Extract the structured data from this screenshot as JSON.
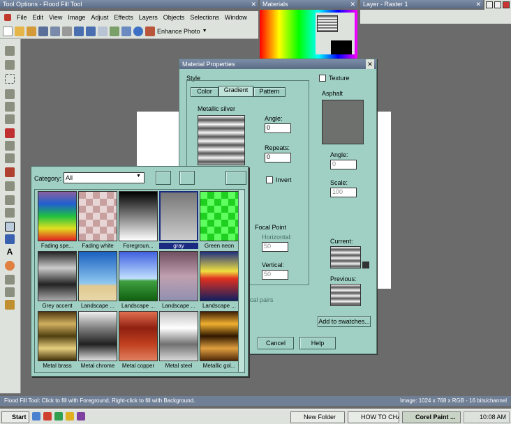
{
  "windows": {
    "tool_options_title": "Tool Options - Flood Fill Tool",
    "materials_title": "Materials",
    "layer_title": "Layer - Raster 1"
  },
  "menu": [
    "File",
    "Edit",
    "View",
    "Image",
    "Adjust",
    "Effects",
    "Layers",
    "Objects",
    "Selections",
    "Window"
  ],
  "toolbar": {
    "enhance_photo": "Enhance Photo"
  },
  "material_properties": {
    "title": "Material Properties",
    "style_label": "Style",
    "tabs": [
      "Color",
      "Gradient",
      "Pattern"
    ],
    "gradient_name": "Metallic silver",
    "angle_label": "Angle:",
    "angle_value": "0",
    "repeats_label": "Repeats:",
    "repeats_value": "0",
    "invert_label": "Invert",
    "focal_point_label": "Focal Point",
    "horizontal_label": "Horizontal:",
    "horizontal_value": "50",
    "vertical_label": "Vertical:",
    "vertical_value": "50",
    "focal_extra": "ocal pairs",
    "texture_label": "Texture",
    "texture_name": "Asphalt",
    "tex_angle_label": "Angle:",
    "tex_angle_value": "0",
    "scale_label": "Scale:",
    "scale_value": "100",
    "current_label": "Current:",
    "previous_label": "Previous:",
    "add_swatches": "Add to swatches...",
    "cancel": "Cancel",
    "help": "Help"
  },
  "popup": {
    "category_label": "Category:",
    "category_value": "All",
    "swatches": [
      "Fading spe...",
      "Fading white",
      "Foregroun...",
      "gray",
      "Green neon",
      "Grey accent",
      "Landscape ...",
      "Landscape ...",
      "Landscape ...",
      "Landscape ...",
      "Metal brass",
      "Metal chrome",
      "Metal copper",
      "Metal steel",
      "Metallic gol..."
    ]
  },
  "status": {
    "left": "Flood Fill Tool: Click to fill with Foreground, Right-click to fill with Background.",
    "right": "Image:  1024 x 768 x RGB - 16 bits/channel"
  },
  "taskbar": {
    "start": "Start",
    "tasks": [
      "New Folder",
      "HOW TO CHA...",
      "Corel Paint ..."
    ],
    "clock": "10:08 AM"
  }
}
